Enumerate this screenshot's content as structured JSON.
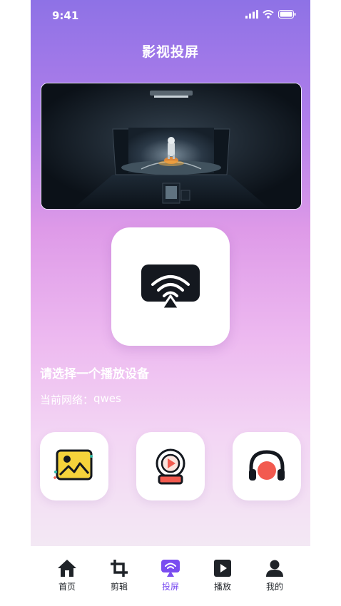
{
  "status_bar": {
    "time": "9:41"
  },
  "header": {
    "title": "影视投屏"
  },
  "main": {
    "prompt": "请选择一个播放设备",
    "network_label": "当前网络：",
    "network_name": "qwes"
  },
  "tiles": [
    {
      "icon": "image-icon"
    },
    {
      "icon": "video-record-icon"
    },
    {
      "icon": "headphones-icon"
    }
  ],
  "tabbar": {
    "items": [
      {
        "label": "首页",
        "icon": "home-icon"
      },
      {
        "label": "剪辑",
        "icon": "crop-icon"
      },
      {
        "label": "投屏",
        "icon": "screencast-icon",
        "active": true
      },
      {
        "label": "播放",
        "icon": "play-icon"
      },
      {
        "label": "我的",
        "icon": "user-icon"
      }
    ]
  },
  "colors": {
    "accent": "#7a4cf0",
    "gradient_top": "#8e72e6",
    "gradient_mid": "#de9ae8",
    "dark": "#14181f",
    "red": "#f25a4f",
    "yellow": "#f5d33b"
  }
}
